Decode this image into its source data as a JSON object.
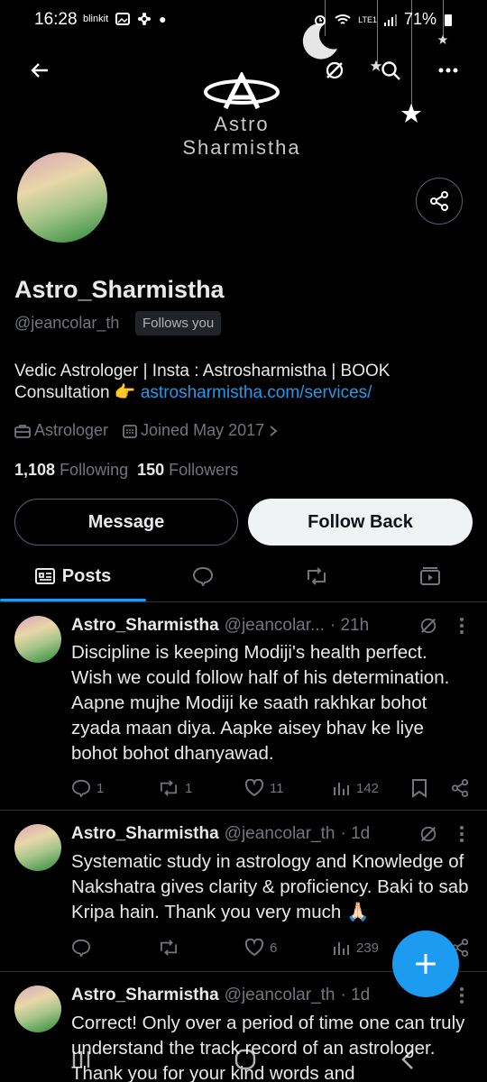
{
  "status": {
    "time": "16:28",
    "notif_app": "blinkit",
    "network": "LTE1",
    "battery": "71%"
  },
  "banner": {
    "logo_text": "Astro Sharmistha"
  },
  "profile": {
    "name": "Astro_Sharmistha",
    "handle": "@jeancolar_th",
    "follows_badge": "Follows you",
    "bio_text": "Vedic Astrologer | Insta : Astrosharmistha | BOOK Consultation 👉 ",
    "bio_link": "astrosharmistha.com/services/",
    "category": "Astrologer",
    "joined": "Joined May 2017",
    "following_count": "1,108",
    "following_label": "Following",
    "followers_count": "150",
    "followers_label": "Followers",
    "message_label": "Message",
    "follow_back_label": "Follow Back"
  },
  "tabs": {
    "posts": "Posts"
  },
  "tweets": [
    {
      "author": "Astro_Sharmistha",
      "handle": "@jeancolar...",
      "time": "· 21h",
      "text": "Discipline is keeping Modiji's health perfect. Wish we could follow half of his determination. Aapne mujhe Modiji ke saath rakhkar bohot zyada maan diya. Aapke aisey bhav ke liye bohot bohot dhanyawad.",
      "replies": "1",
      "retweets": "1",
      "likes": "11",
      "views": "142"
    },
    {
      "author": "Astro_Sharmistha",
      "handle": "@jeancolar_th",
      "time": "· 1d",
      "text": "Systematic study in astrology and Knowledge of Nakshatra gives clarity & proficiency. Baki to sab Kripa hain. Thank you very much 🙏🏻",
      "replies": "",
      "retweets": "",
      "likes": "6",
      "views": "239"
    },
    {
      "author": "Astro_Sharmistha",
      "handle": "@jeancolar_th",
      "time": "· 1d",
      "text": "Correct! Only over a period of time one can truly understand the track record of an astrologer. Thank you for your kind words and"
    }
  ],
  "colors": {
    "accent": "#1d9bf0",
    "background": "#000000",
    "muted": "#71767b"
  }
}
